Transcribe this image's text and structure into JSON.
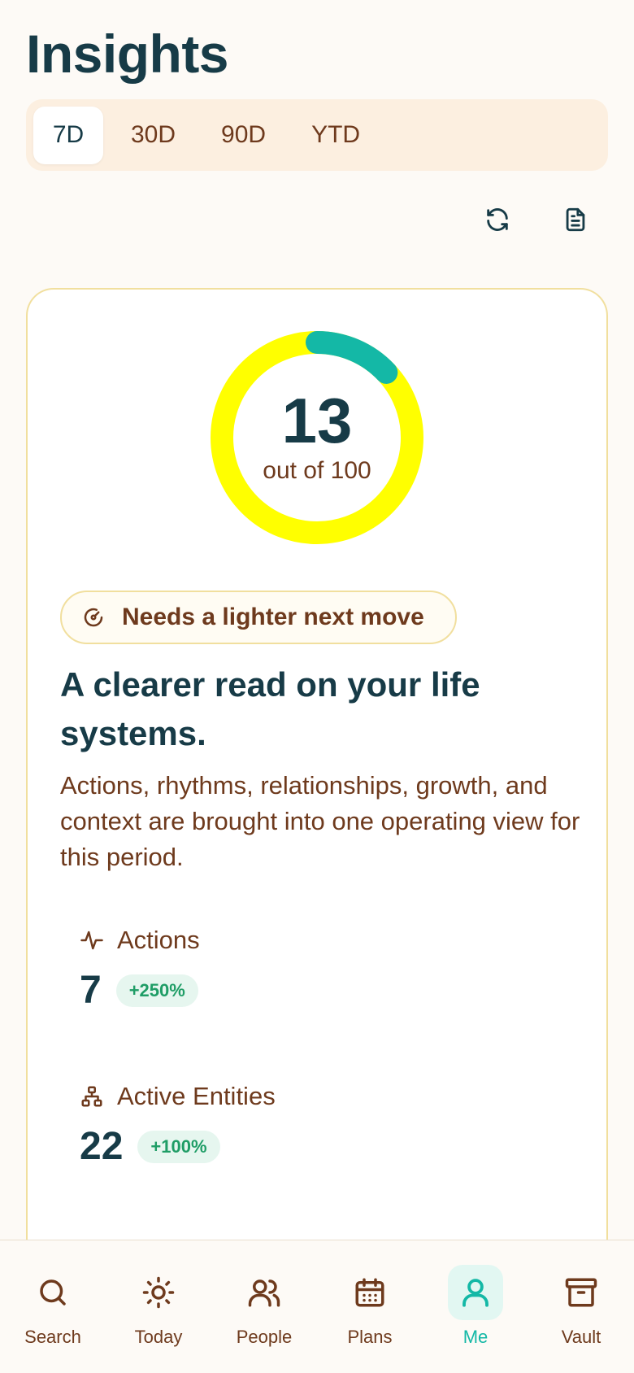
{
  "header": {
    "title": "Insights"
  },
  "periods": {
    "selected": "7D",
    "items": [
      "7D",
      "30D",
      "90D",
      "YTD"
    ]
  },
  "toolbar": {
    "refresh_icon": "refresh-icon",
    "report_icon": "document-icon"
  },
  "score": {
    "value": "13",
    "subtitle": "out of 100",
    "fraction": 0.13,
    "track_color": "#ffff00",
    "progress_color": "#14b8a6"
  },
  "status": {
    "icon": "gauge-icon",
    "label": "Needs a lighter next move"
  },
  "summary": {
    "headline": "A clearer read on your life systems.",
    "description": "Actions, rhythms, relationships, growth, and context are brought into one operating view for this period."
  },
  "metrics": [
    {
      "icon": "activity-icon",
      "label": "Actions",
      "value": "7",
      "delta": "+250%"
    },
    {
      "icon": "hierarchy-icon",
      "label": "Active Entities",
      "value": "22",
      "delta": "+100%"
    }
  ],
  "nav": {
    "active": "Me",
    "items": [
      {
        "label": "Search",
        "icon": "search-icon"
      },
      {
        "label": "Today",
        "icon": "sun-icon"
      },
      {
        "label": "People",
        "icon": "people-icon"
      },
      {
        "label": "Plans",
        "icon": "calendar-icon"
      },
      {
        "label": "Me",
        "icon": "user-icon"
      },
      {
        "label": "Vault",
        "icon": "archive-icon"
      }
    ]
  },
  "colors": {
    "brand_dark": "#173b47",
    "text_brown": "#6e3a1d",
    "accent_teal": "#14b8a6",
    "positive_green": "#1f9d66"
  }
}
